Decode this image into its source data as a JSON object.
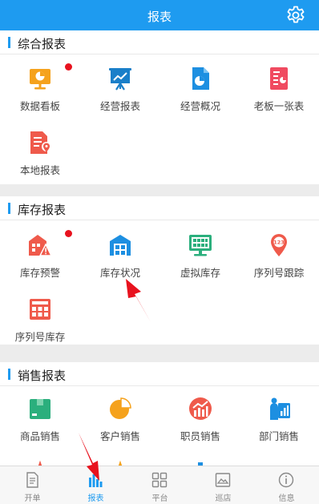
{
  "header": {
    "title": "报表"
  },
  "sections": [
    {
      "title": "综合报表",
      "items": [
        {
          "label": "数据看板",
          "icon": "dashboard-board-icon",
          "badge": true
        },
        {
          "label": "经营报表",
          "icon": "presentation-chart-icon",
          "badge": false
        },
        {
          "label": "经营概况",
          "icon": "pie-document-icon",
          "badge": false
        },
        {
          "label": "老板一张表",
          "icon": "boss-sheet-icon",
          "badge": false
        },
        {
          "label": "本地报表",
          "icon": "local-report-icon",
          "badge": false
        }
      ]
    },
    {
      "title": "库存报表",
      "items": [
        {
          "label": "库存预警",
          "icon": "warehouse-warning-icon",
          "badge": true
        },
        {
          "label": "库存状况",
          "icon": "warehouse-status-icon",
          "badge": false
        },
        {
          "label": "虚拟库存",
          "icon": "virtual-stock-icon",
          "badge": false
        },
        {
          "label": "序列号跟踪",
          "icon": "serial-tracking-icon",
          "badge": false
        },
        {
          "label": "序列号库存",
          "icon": "serial-stock-icon",
          "badge": false
        }
      ]
    },
    {
      "title": "销售报表",
      "items": [
        {
          "label": "商品销售",
          "icon": "product-sales-icon",
          "badge": false
        },
        {
          "label": "客户销售",
          "icon": "customer-sales-icon",
          "badge": false
        },
        {
          "label": "职员销售",
          "icon": "staff-sales-icon",
          "badge": false
        },
        {
          "label": "部门销售",
          "icon": "department-sales-icon",
          "badge": false
        }
      ]
    }
  ],
  "tabbar": [
    {
      "label": "开单",
      "icon": "order-form-icon",
      "active": false
    },
    {
      "label": "报表",
      "icon": "report-bars-icon",
      "active": true
    },
    {
      "label": "平台",
      "icon": "platform-grid-icon",
      "active": false
    },
    {
      "label": "巡店",
      "icon": "store-patrol-icon",
      "active": false
    },
    {
      "label": "信息",
      "icon": "info-circle-icon",
      "active": false
    }
  ],
  "colors": {
    "header_bg": "#1e9bf0",
    "accent": "#1e9bf0",
    "badge": "#e8121e",
    "annotation_arrow": "#e8121e"
  }
}
